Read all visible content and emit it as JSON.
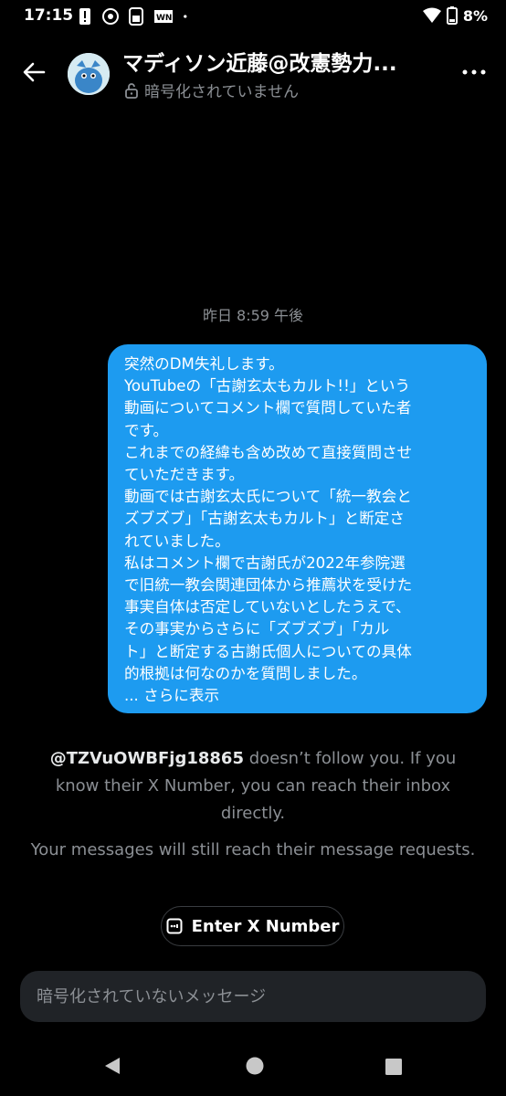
{
  "status_bar": {
    "time": "17:15",
    "battery": "8%",
    "icons_left": [
      "alert-icon",
      "app-icon",
      "sim-icon",
      "news-icon",
      "dot-icon"
    ],
    "icons_right": [
      "wifi-icon",
      "battery-icon"
    ]
  },
  "header": {
    "contact_name": "マディソン近藤@改憲勢力...",
    "encryption_status": "暗号化されていません"
  },
  "conversation": {
    "timestamp": "昨日 8:59 午後",
    "message_lines": [
      "突然のDM失礼します。",
      "YouTubeの「古謝玄太もカルト!!」という",
      "動画についてコメント欄で質問していた者",
      "です。",
      "これまでの経緯も含め改めて直接質問させ",
      "ていただきます。",
      "動画では古謝玄太氏について「統一教会と",
      "ズブズブ」「古謝玄太もカルト」と断定さ",
      "れていました。",
      "私はコメント欄で古謝氏が2022年参院選",
      "で旧統一教会関連団体から推薦状を受けた",
      "事実自体は否定していないとしたうえで、",
      "その事実からさらに「ズブズブ」「カル",
      "ト」と断定する古謝氏個人についての具体",
      "的根拠は何なのかを質問しました。"
    ],
    "show_more": "... さらに表示",
    "bubble_color": "#1d9bf0"
  },
  "notice": {
    "handle": "@TZVuOWBFjg18865",
    "text": " doesn’t follow you. If you know their X Number, you can reach their inbox directly.",
    "secondary": "Your messages will still reach their message requests.",
    "button_label": "Enter X Number"
  },
  "composer": {
    "placeholder": "暗号化されていないメッセージ"
  }
}
